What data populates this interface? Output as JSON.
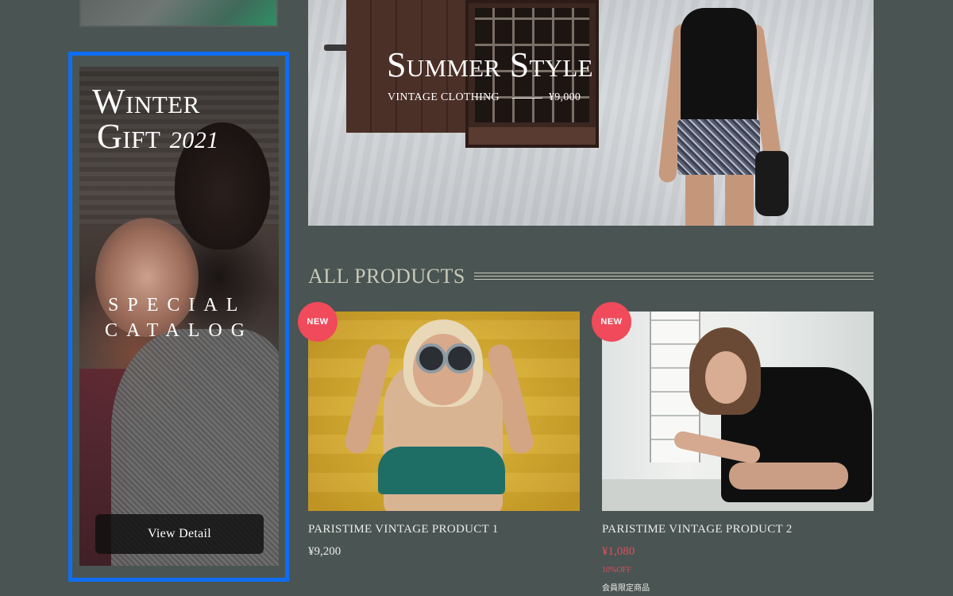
{
  "sidebar": {
    "banner": {
      "title_line1": "Winter",
      "title_line2": "Gift",
      "year": "2021",
      "catalog_line1": "SPECIAL",
      "catalog_line2": "CATALOG",
      "button_label": "View Detail"
    }
  },
  "hero": {
    "title": "Summer Style",
    "subtitle": "VINTAGE CLOTHING",
    "price": "¥9,000"
  },
  "products_section": {
    "title": "ALL PRODUCTS",
    "items": [
      {
        "badge": "NEW",
        "name": "PARISTIME VINTAGE PRODUCT 1",
        "price": "¥9,200"
      },
      {
        "badge": "NEW",
        "name": "PARISTIME VINTAGE PRODUCT 2",
        "price": "¥1,080",
        "discount": "10%OFF",
        "note": "会員限定商品"
      }
    ]
  },
  "colors": {
    "background": "#4a5452",
    "selection_outline": "#0d6ef2",
    "badge": "#f04a5b",
    "sale_price": "#e34d5c",
    "section_title": "#c7c9b8"
  }
}
